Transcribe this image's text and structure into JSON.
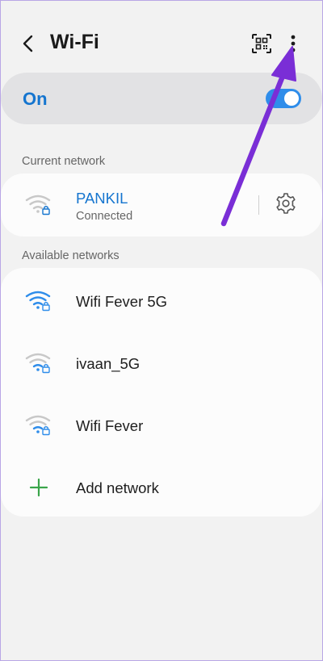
{
  "header": {
    "title": "Wi-Fi"
  },
  "toggle": {
    "label": "On",
    "state": "on"
  },
  "current": {
    "section_label": "Current network",
    "network": {
      "name": "PANKIL",
      "status": "Connected"
    }
  },
  "available": {
    "section_label": "Available networks",
    "networks": [
      {
        "name": "Wifi Fever 5G",
        "signal": "strong"
      },
      {
        "name": "ivaan_5G",
        "signal": "weak"
      },
      {
        "name": "Wifi Fever",
        "signal": "weak"
      }
    ],
    "add_label": "Add network"
  },
  "colors": {
    "accent": "#1575cf",
    "toggle_on": "#2f8dea",
    "add": "#3aa54a",
    "annotation_arrow": "#7a2ed6"
  },
  "icons": {
    "back": "chevron-left-icon",
    "qr": "qr-scan-icon",
    "more": "more-vertical-icon",
    "settings": "gear-icon",
    "wifi": "wifi-lock-icon",
    "add": "plus-icon"
  }
}
